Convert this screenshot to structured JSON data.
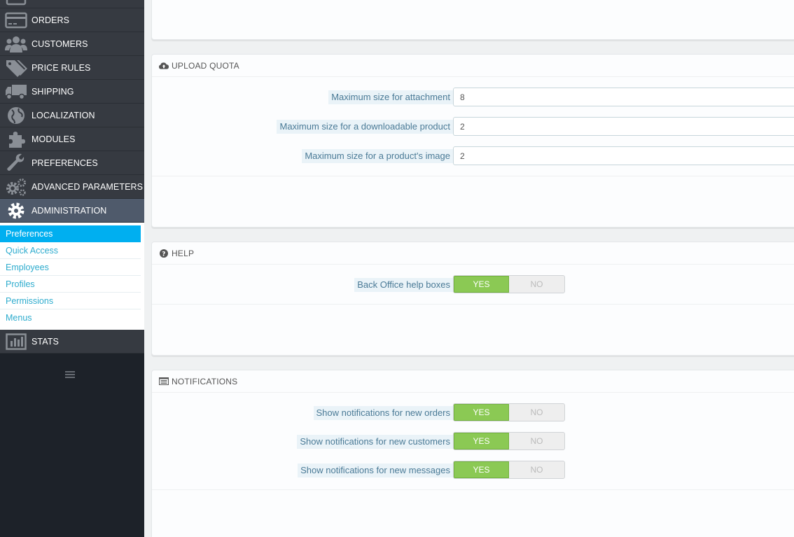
{
  "sidebar": {
    "items": [
      {
        "label": "ORDERS",
        "icon": "credit-card-icon"
      },
      {
        "label": "CUSTOMERS",
        "icon": "users-icon"
      },
      {
        "label": "PRICE RULES",
        "icon": "tags-icon"
      },
      {
        "label": "SHIPPING",
        "icon": "truck-icon"
      },
      {
        "label": "LOCALIZATION",
        "icon": "globe-icon"
      },
      {
        "label": "MODULES",
        "icon": "puzzle-icon"
      },
      {
        "label": "PREFERENCES",
        "icon": "wrench-icon"
      },
      {
        "label": "ADVANCED PARAMETERS",
        "icon": "cogs-icon"
      },
      {
        "label": "ADMINISTRATION",
        "icon": "gear-icon"
      },
      {
        "label": "STATS",
        "icon": "bar-chart-icon"
      }
    ],
    "submenu": [
      "Preferences",
      "Quick Access",
      "Employees",
      "Profiles",
      "Permissions",
      "Menus"
    ]
  },
  "upload_quota": {
    "title": "UPLOAD QUOTA",
    "fields": [
      {
        "label": "Maximum size for attachment",
        "value": "8"
      },
      {
        "label": "Maximum size for a downloadable product",
        "value": "2"
      },
      {
        "label": "Maximum size for a product's image",
        "value": "2"
      }
    ]
  },
  "help": {
    "title": "HELP",
    "fields": [
      {
        "label": "Back Office help boxes",
        "yes": "YES",
        "no": "NO"
      }
    ]
  },
  "notifications": {
    "title": "NOTIFICATIONS",
    "fields": [
      {
        "label": "Show notifications for new orders",
        "yes": "YES",
        "no": "NO"
      },
      {
        "label": "Show notifications for new customers",
        "yes": "YES",
        "no": "NO"
      },
      {
        "label": "Show notifications for new messages",
        "yes": "YES",
        "no": "NO"
      }
    ]
  },
  "colors": {
    "sidebar_bg": "#363a41",
    "active_submenu": "#00aff0",
    "switch_on": "#8bc954",
    "label_text": "#4a7a96"
  }
}
